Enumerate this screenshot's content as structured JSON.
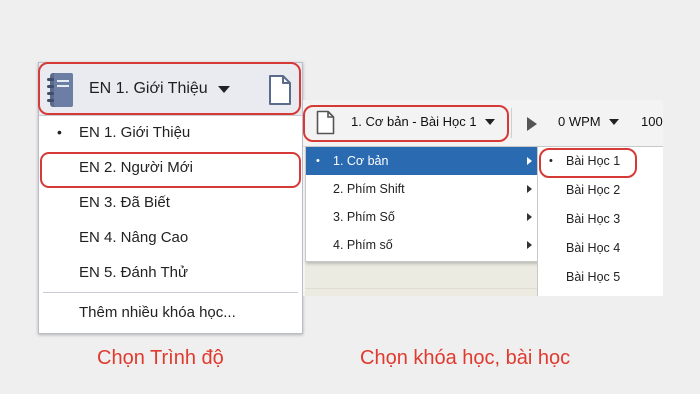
{
  "left": {
    "selected_level": "EN 1. Giới Thiệu",
    "level_items": [
      {
        "label": "EN 1. Giới Thiệu",
        "selected": true
      },
      {
        "label": "EN 2. Người Mới",
        "selected": false
      },
      {
        "label": "EN 3. Đã Biết",
        "selected": false
      },
      {
        "label": "EN 4. Nâng Cao",
        "selected": false
      },
      {
        "label": "EN 5. Đánh Thử",
        "selected": false
      }
    ],
    "more_courses": "Thêm nhiều khóa học...",
    "caption": "Chọn Trình độ",
    "bullet": "•"
  },
  "right": {
    "lesson_dropdown": "1. Cơ bản - Bài Học 1",
    "wpm": "0 WPM",
    "zoom": "100",
    "course_items": [
      {
        "label": "1. Cơ bản",
        "active": true
      },
      {
        "label": "2. Phím Shift",
        "active": false
      },
      {
        "label": "3. Phím Số",
        "active": false
      },
      {
        "label": "4. Phím số",
        "active": false
      }
    ],
    "lesson_items": [
      {
        "label": "Bài Học 1",
        "selected": true
      },
      {
        "label": "Bài Học 2",
        "selected": false
      },
      {
        "label": "Bài Học 3",
        "selected": false
      },
      {
        "label": "Bài Học 4",
        "selected": false
      },
      {
        "label": "Bài Học 5",
        "selected": false
      }
    ],
    "caption": "Chọn khóa học, bài học"
  },
  "colors": {
    "highlight": "#d63a36",
    "caption": "#e03a2f",
    "active_menu": "#2a6ab0"
  },
  "icons": [
    "notebook-icon",
    "file-icon",
    "caret-down-icon",
    "play-icon",
    "submenu-arrow-icon"
  ]
}
